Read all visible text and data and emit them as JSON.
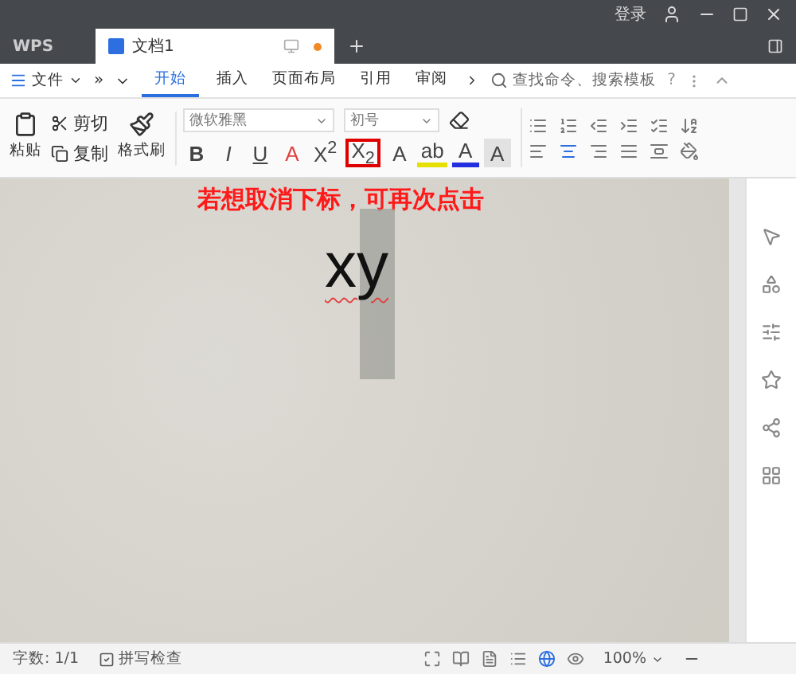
{
  "title_bar": {
    "login": "登录"
  },
  "tabs": [
    {
      "label": "WPS",
      "kind": "app",
      "selected": false
    },
    {
      "label": "文档1",
      "kind": "document",
      "selected": true
    }
  ],
  "menu": {
    "file": "文件",
    "more": "»",
    "tabs": [
      {
        "label": "开始",
        "selected": true
      },
      {
        "label": "插入",
        "selected": false
      },
      {
        "label": "页面布局",
        "selected": false
      },
      {
        "label": "引用",
        "selected": false
      },
      {
        "label": "审阅",
        "selected": false
      }
    ],
    "search": {
      "placeholder": "查找命令、搜索模板"
    },
    "help": "?"
  },
  "clipboard": {
    "paste": "粘贴",
    "cut": "剪切",
    "copy": "复制",
    "format_painter": "格式刷"
  },
  "font": {
    "name": "微软雅黑",
    "size": "初号"
  },
  "format_buttons": [
    {
      "kind": "bold",
      "label": "B",
      "highlighted": false
    },
    {
      "kind": "italic",
      "label": "I",
      "highlighted": false
    },
    {
      "kind": "underline",
      "label": "U",
      "highlighted": false
    },
    {
      "kind": "strike",
      "label": "A",
      "highlighted": false
    },
    {
      "kind": "script",
      "label": "X$^{2}$",
      "highlighted": false
    },
    {
      "kind": "script",
      "label": "X$_{2}$",
      "highlighted": true
    },
    {
      "kind": "plain",
      "label": "A",
      "highlighted": false
    },
    {
      "kind": "highlight",
      "label": "ab",
      "highlighted": false
    },
    {
      "kind": "fontcolor",
      "label": "A",
      "highlighted": false
    },
    {
      "kind": "shade",
      "label": "A",
      "highlighted": false
    }
  ],
  "document": {
    "annotation": "若想取消下标，可再次点击",
    "text": "xy"
  },
  "status_bar": {
    "word_count": "字数: 1/1",
    "spell_check": "拼写检查",
    "zoom": "100%"
  }
}
